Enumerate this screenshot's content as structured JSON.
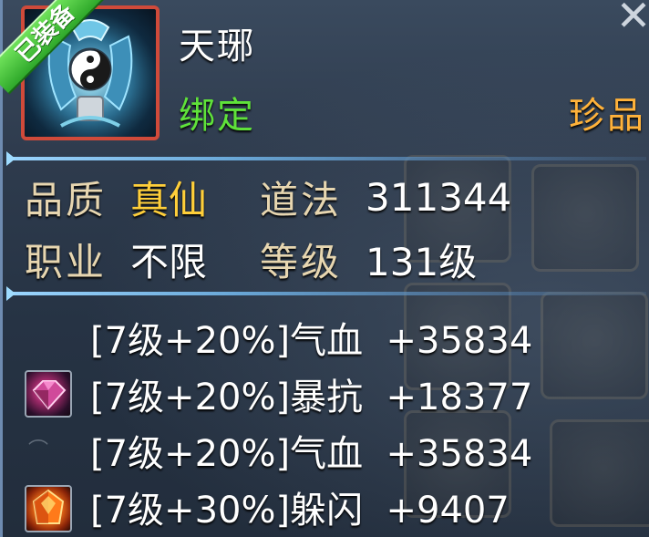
{
  "item": {
    "name": "天琊",
    "equipped_badge": "已装备",
    "bind": "绑定",
    "rarity": "珍品",
    "close_icon": "close-x-icon"
  },
  "attributes": {
    "quality_label": "品质",
    "quality_value": "真仙",
    "dao_label": "道法",
    "dao_value": "311344",
    "class_label": "职业",
    "class_value": "不限",
    "level_label": "等级",
    "level_value": "131级"
  },
  "gem_stats": [
    {
      "text": "[7级+20%]气血  +35834",
      "gem": "none"
    },
    {
      "text": "[7级+20%]暴抗  +18377",
      "gem": "purple-gem-icon"
    },
    {
      "text": "[7级+20%]气血  +35834",
      "gem": "none"
    },
    {
      "text": "[7级+30%]躲闪  +9407",
      "gem": "orange-gem-icon"
    }
  ],
  "colors": {
    "name": "#ffffff",
    "bind": "#5fe23a",
    "rarity": "#ffb23a",
    "quality": "#ffcf3a",
    "attr_label": "#e7d6b0",
    "equipped_badge": "#2ea82a",
    "icon_border": "#d04a3a"
  }
}
